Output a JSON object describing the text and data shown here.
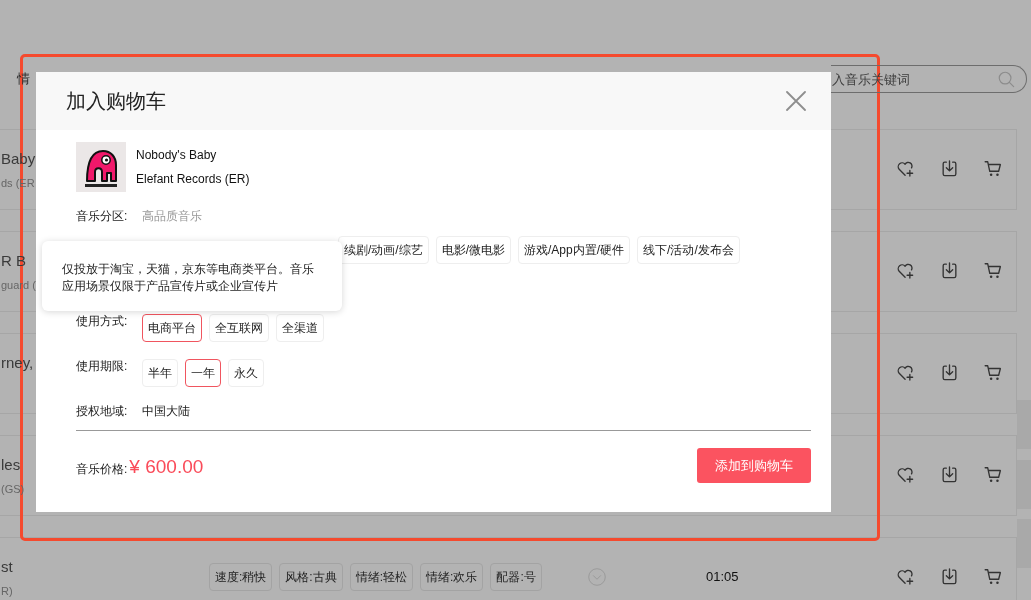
{
  "page": {
    "category_label": "情",
    "search": {
      "placeholder": "入音乐关键词"
    }
  },
  "tracks": [
    {
      "title": "Baby",
      "subtitle": "ds (ER"
    },
    {
      "title": "R B",
      "subtitle": "guard ("
    },
    {
      "title": "rney,"
    },
    {
      "title": "les",
      "subtitle": "(GS)"
    },
    {
      "title": "st",
      "subtitle": "R)",
      "tags": [
        "速度:稍快",
        "风格:古典",
        "情绪:轻松",
        "情绪:欢乐",
        "配器:号"
      ],
      "duration": "01:05"
    }
  ],
  "dialog": {
    "title": "加入购物车",
    "track": {
      "name": "Nobody's Baby",
      "label": "Elefant Records (ER)"
    },
    "fields": [
      {
        "kind": "text",
        "label": "音乐分区:",
        "value": "高品质音乐",
        "muted": true
      },
      {
        "kind": "options",
        "options": [
          {
            "label": "续剧/动画/综艺",
            "selected": false
          },
          {
            "label": "电影/微电影",
            "selected": false
          },
          {
            "label": "游戏/App内置/硬件",
            "selected": false
          },
          {
            "label": "线下/活动/发布会",
            "selected": false
          }
        ],
        "tooltip": "仅投放于淘宝，天猫，京东等电商类平台。音乐应用场景仅限于产品宣传片或企业宣传片"
      },
      {
        "kind": "options",
        "label": "使用方式:",
        "options": [
          {
            "label": "电商平台",
            "selected": true
          },
          {
            "label": "全互联网",
            "selected": false
          },
          {
            "label": "全渠道",
            "selected": false
          }
        ]
      },
      {
        "kind": "options",
        "label": "使用期限:",
        "options": [
          {
            "label": "半年",
            "selected": false
          },
          {
            "label": "一年",
            "selected": true
          },
          {
            "label": "永久",
            "selected": false
          }
        ]
      },
      {
        "kind": "text",
        "label": "授权地域:",
        "value": "中国大陆",
        "muted": false
      }
    ],
    "price_label": "音乐价格:",
    "price": "¥ 600.00",
    "submit": "添加到购物车"
  }
}
